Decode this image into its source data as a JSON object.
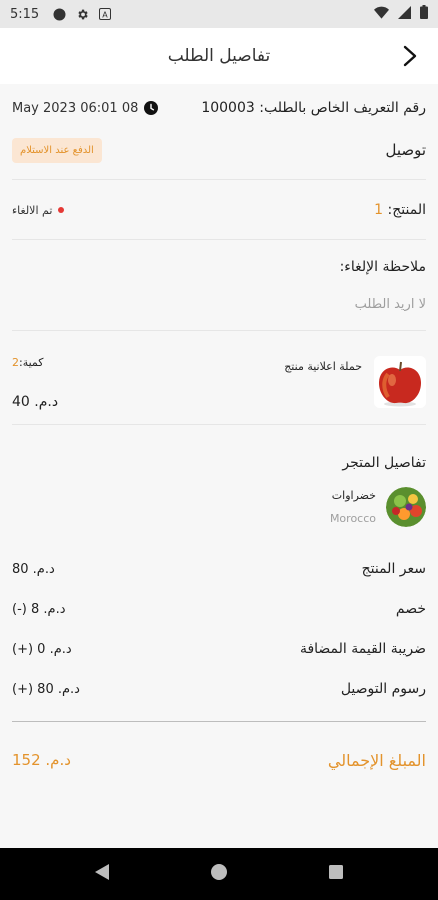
{
  "status_bar": {
    "time": "5:15",
    "icons": [
      "circle-icon",
      "gear-icon",
      "a-icon"
    ],
    "right_icons": [
      "wifi-icon",
      "signal-icon",
      "battery-icon"
    ]
  },
  "header": {
    "title": "تفاصيل الطلب",
    "back_icon": "chevron-right-icon"
  },
  "order": {
    "id_label": "رقم التعريف الخاص بالطلب:",
    "id_value": "100003",
    "datetime": "May 2023  06:01 08",
    "delivery_label": "توصيل",
    "payment_badge": "الدفع عند الاستلام",
    "product_label": "المنتج:",
    "product_count": "1",
    "status_text": "تم الالغاء",
    "status_color": "#e53935"
  },
  "cancel_note": {
    "title": "ملاحظة الإلغاء:",
    "text": "لا اريد الطلب"
  },
  "item": {
    "name": "حملة اعلانية منتج",
    "qty_label": "كمية:",
    "qty_value": "2",
    "price": "د.م. 40"
  },
  "store": {
    "section_title": "تفاصيل المتجر",
    "name": "خضراوات",
    "country": "Morocco"
  },
  "summary": {
    "product_price_label": "سعر المنتج",
    "product_price_value": "د.م. 80",
    "discount_label": "خصم",
    "discount_value": "د.م. 8 (-)",
    "vat_label": "ضريبة القيمة المضافة",
    "vat_value": "د.م. 0 (+)",
    "delivery_fee_label": "رسوم التوصيل",
    "delivery_fee_value": "د.م. 80 (+)",
    "total_label": "المبلغ الإجمالي",
    "total_value": "د.م. 152"
  },
  "colors": {
    "accent": "#e3932c",
    "badge_bg": "#fbe6d3",
    "background": "#f7f7f7"
  },
  "nav": {
    "icons": [
      "back-triangle-icon",
      "home-circle-icon",
      "recents-square-icon"
    ]
  }
}
